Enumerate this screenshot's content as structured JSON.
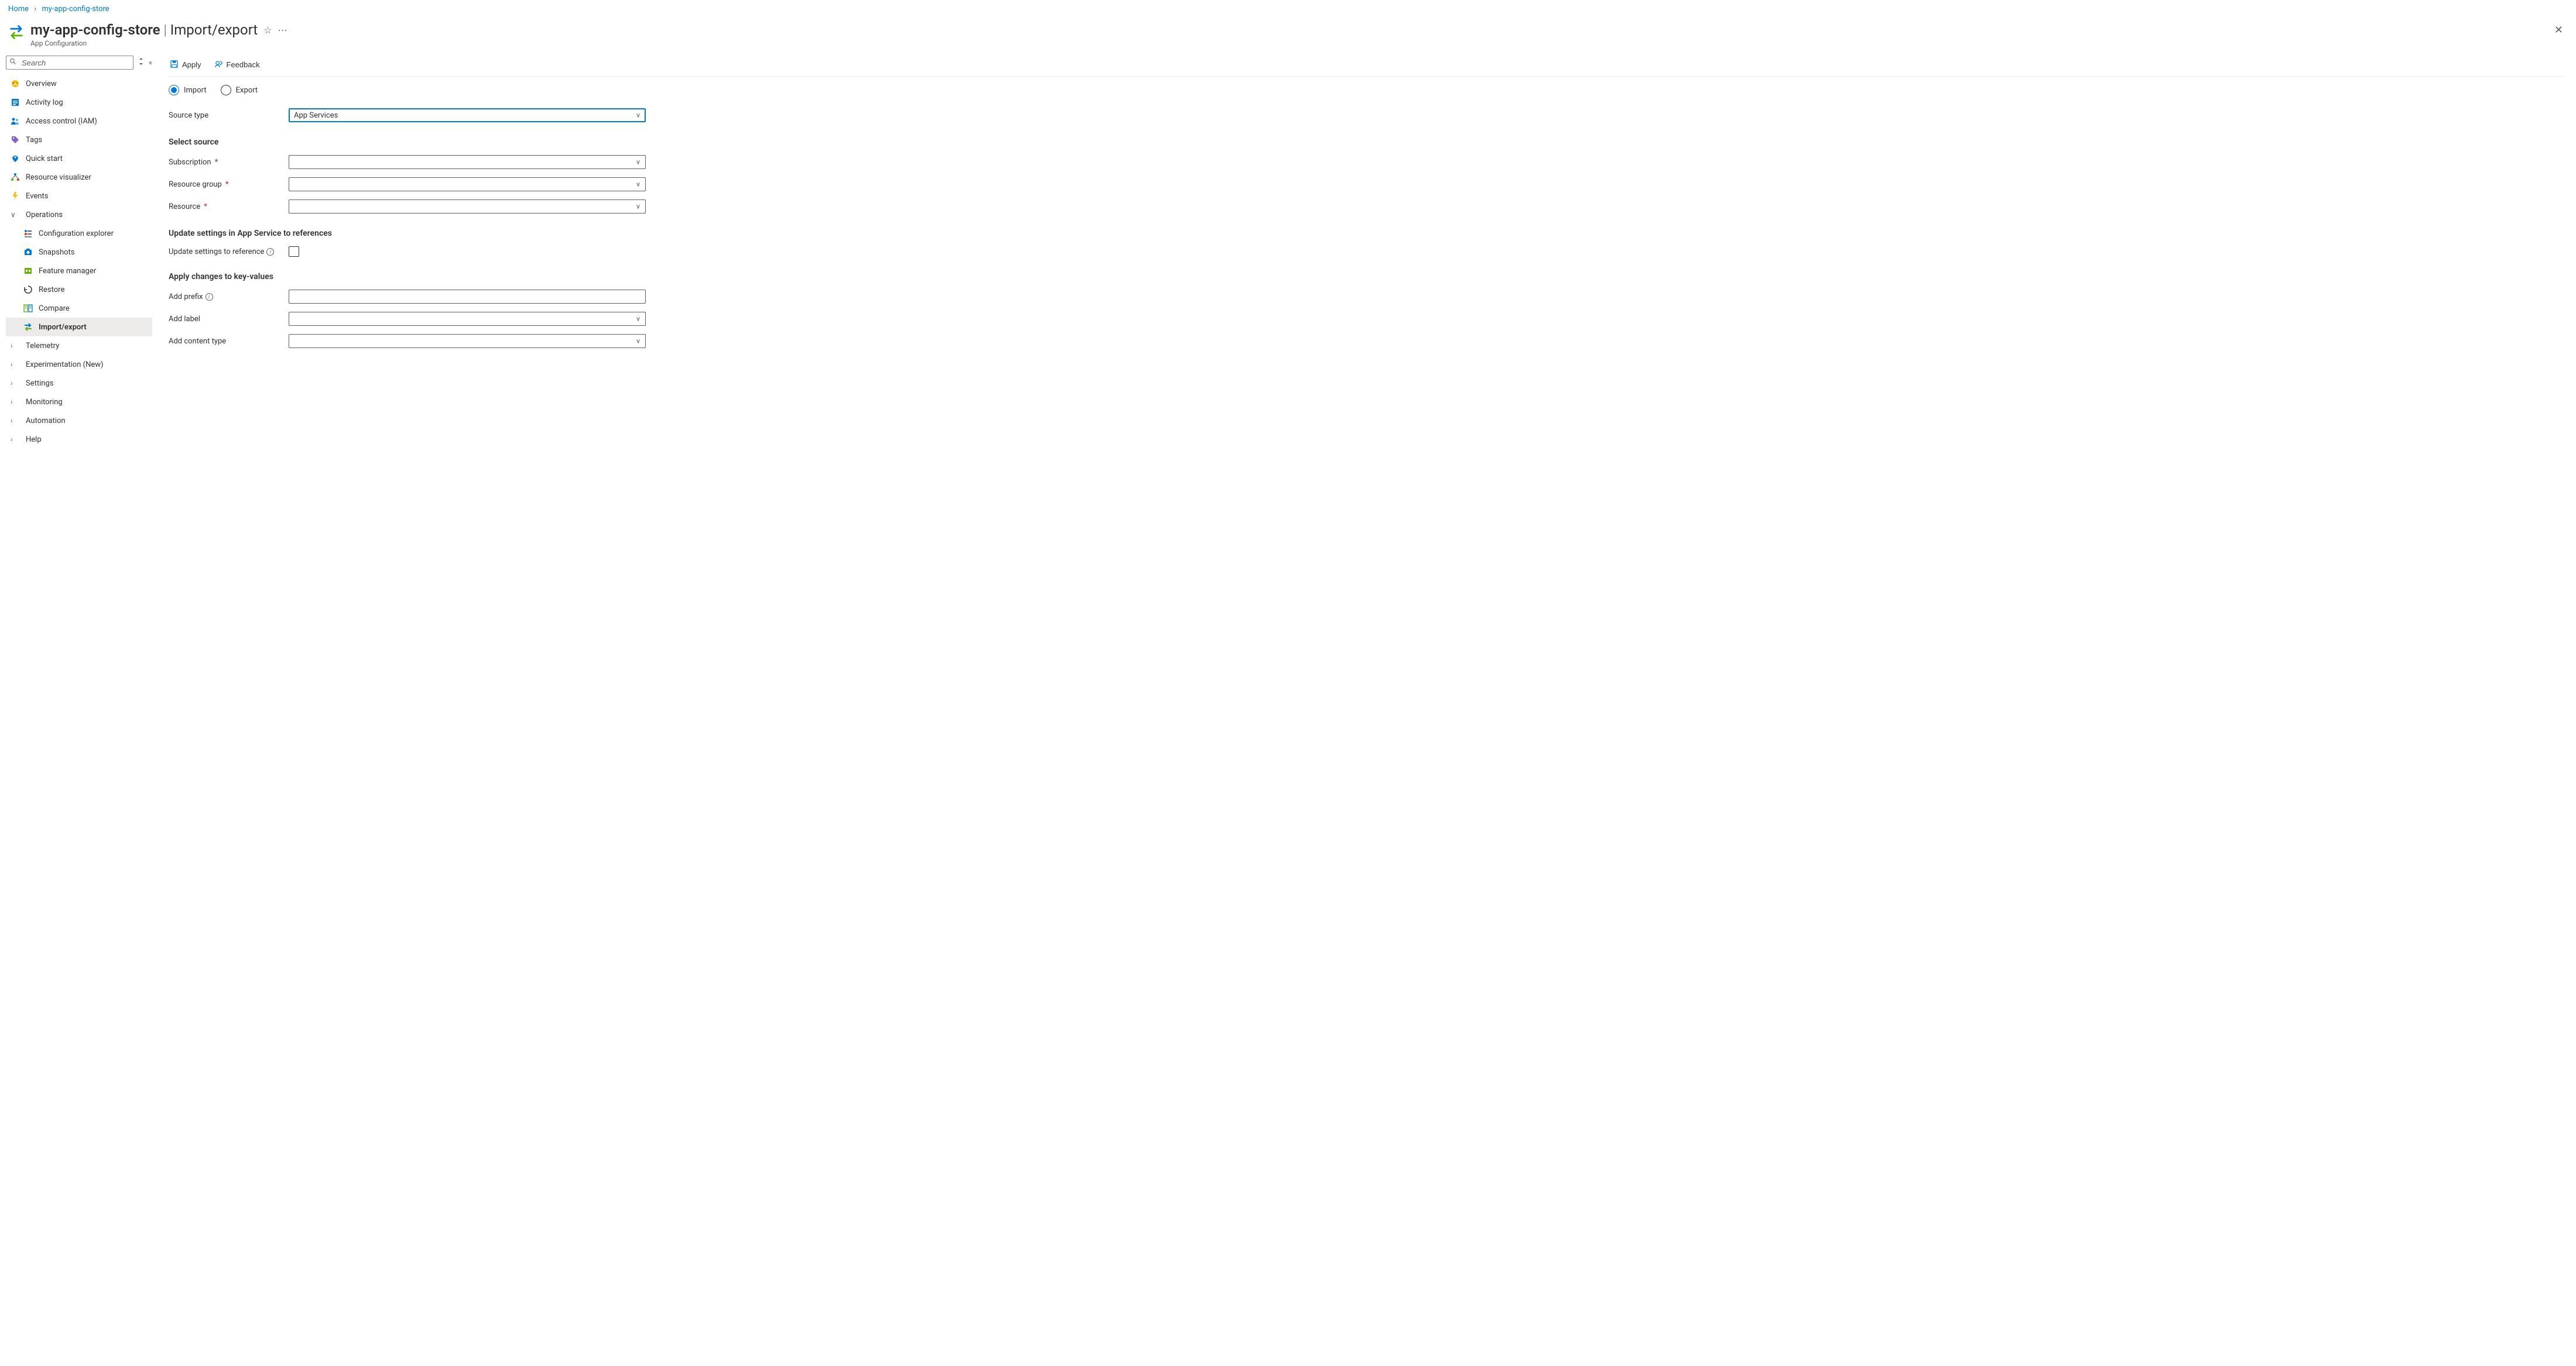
{
  "breadcrumb": {
    "home": "Home",
    "current": "my-app-config-store"
  },
  "header": {
    "resource_name": "my-app-config-store",
    "page_name": "Import/export",
    "service_name": "App Configuration"
  },
  "sidebar": {
    "search_placeholder": "Search",
    "items": [
      {
        "label": "Overview",
        "icon": "overview"
      },
      {
        "label": "Activity log",
        "icon": "activitylog"
      },
      {
        "label": "Access control (IAM)",
        "icon": "iam"
      },
      {
        "label": "Tags",
        "icon": "tags"
      },
      {
        "label": "Quick start",
        "icon": "quickstart"
      },
      {
        "label": "Resource visualizer",
        "icon": "visualizer"
      },
      {
        "label": "Events",
        "icon": "events"
      }
    ],
    "operations": {
      "label": "Operations",
      "items": [
        {
          "label": "Configuration explorer",
          "icon": "configexplorer"
        },
        {
          "label": "Snapshots",
          "icon": "snapshots"
        },
        {
          "label": "Feature manager",
          "icon": "featuremanager"
        },
        {
          "label": "Restore",
          "icon": "restore"
        },
        {
          "label": "Compare",
          "icon": "compare"
        },
        {
          "label": "Import/export",
          "icon": "importexport",
          "selected": true
        }
      ]
    },
    "groups": [
      {
        "label": "Telemetry"
      },
      {
        "label": "Experimentation (New)"
      },
      {
        "label": "Settings"
      },
      {
        "label": "Monitoring"
      },
      {
        "label": "Automation"
      },
      {
        "label": "Help"
      }
    ]
  },
  "toolbar": {
    "apply": "Apply",
    "feedback": "Feedback"
  },
  "main": {
    "radio": {
      "import": "Import",
      "export": "Export",
      "selected": "import"
    },
    "source_type": {
      "label": "Source type",
      "value": "App Services"
    },
    "select_source": {
      "heading": "Select source",
      "subscription_label": "Subscription",
      "resource_group_label": "Resource group",
      "resource_label": "Resource"
    },
    "update_refs": {
      "heading": "Update settings in App Service to references",
      "checkbox_label": "Update settings to reference",
      "checked": false
    },
    "apply_changes": {
      "heading": "Apply changes to key-values",
      "add_prefix_label": "Add prefix",
      "add_label_label": "Add label",
      "add_content_type_label": "Add content type"
    }
  }
}
